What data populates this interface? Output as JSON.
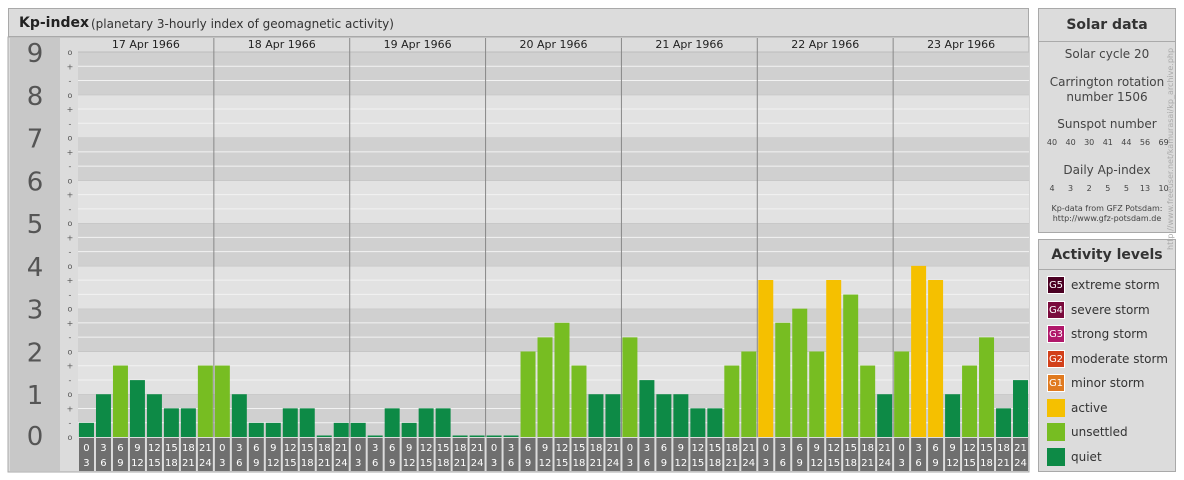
{
  "header": {
    "title": "Kp-index",
    "subtitle": "(planetary 3-hourly index of geomagnetic activity)"
  },
  "solar": {
    "title": "Solar data",
    "cycle": "Solar cycle 20",
    "carrington_line1": "Carrington rotation",
    "carrington_line2": "number 1506",
    "sunspot_label": "Sunspot number",
    "sunspot_values": [
      "40",
      "40",
      "30",
      "41",
      "44",
      "56",
      "69"
    ],
    "ap_label": "Daily Ap-index",
    "ap_values": [
      "4",
      "3",
      "2",
      "5",
      "5",
      "13",
      "10"
    ],
    "source_line1": "Kp-data from GFZ Potsdam:",
    "source_line2": "http://www.gfz-potsdam.de"
  },
  "levels": {
    "title": "Activity levels",
    "items": [
      {
        "code": "G5",
        "label": "extreme storm",
        "color": "#4a0022"
      },
      {
        "code": "G4",
        "label": "severe storm",
        "color": "#7a0a3c"
      },
      {
        "code": "G3",
        "label": "strong storm",
        "color": "#b0186a"
      },
      {
        "code": "G2",
        "label": "moderate storm",
        "color": "#d2401a"
      },
      {
        "code": "G1",
        "label": "minor storm",
        "color": "#e07a20"
      },
      {
        "code": "",
        "label": "active",
        "color": "#f5c000"
      },
      {
        "code": "",
        "label": "unsettled",
        "color": "#77bd22"
      },
      {
        "code": "",
        "label": "quiet",
        "color": "#0d8a46"
      }
    ]
  },
  "watermark": "http://www.freeuser.net/kamurasai/kp_archive.php",
  "chart_data": {
    "type": "bar",
    "title": "Kp-index",
    "ylim": [
      0,
      9
    ],
    "y_ticks": [
      "0",
      "1",
      "2",
      "3",
      "4",
      "5",
      "6",
      "7",
      "8",
      "9"
    ],
    "y_subticks": [
      "o",
      "+",
      "-"
    ],
    "days": [
      "17 Apr 1966",
      "18 Apr 1966",
      "19 Apr 1966",
      "20 Apr 1966",
      "21 Apr 1966",
      "22 Apr 1966",
      "23 Apr 1966"
    ],
    "hour_starts": [
      "0",
      "3",
      "6",
      "9",
      "12",
      "15",
      "18",
      "21"
    ],
    "hour_ends": [
      "3",
      "6",
      "9",
      "12",
      "15",
      "18",
      "21",
      "24"
    ],
    "colors": {
      "quiet": "#0d8a46",
      "unsettled": "#77bd22",
      "active": "#f5c000"
    },
    "series": [
      {
        "values": [
          0.33,
          1.0,
          1.67,
          1.33,
          1.0,
          0.67,
          0.67,
          1.67
        ]
      },
      {
        "values": [
          1.67,
          1.0,
          0.33,
          0.33,
          0.67,
          0.67,
          0.0,
          0.33
        ]
      },
      {
        "values": [
          0.33,
          0.0,
          0.67,
          0.33,
          0.67,
          0.67,
          0.0,
          0.0
        ]
      },
      {
        "values": [
          0.0,
          0.0,
          2.0,
          2.33,
          2.67,
          1.67,
          1.0,
          1.0
        ]
      },
      {
        "values": [
          2.33,
          1.33,
          1.0,
          1.0,
          0.67,
          0.67,
          1.67,
          2.0
        ]
      },
      {
        "values": [
          3.67,
          2.67,
          3.0,
          2.0,
          3.67,
          3.33,
          1.67,
          1.0
        ]
      },
      {
        "values": [
          2.0,
          4.0,
          3.67,
          1.0,
          1.67,
          2.33,
          0.67,
          1.33
        ]
      }
    ]
  }
}
